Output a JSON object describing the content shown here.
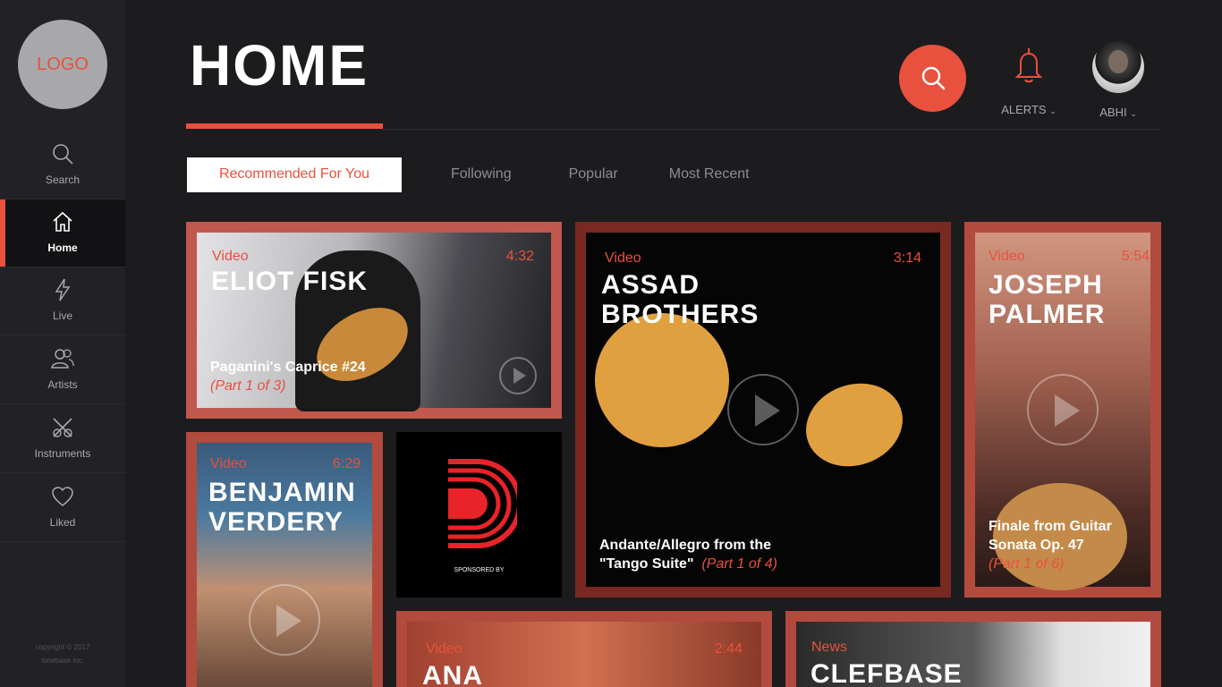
{
  "sidebar": {
    "logo": "LOGO",
    "items": [
      {
        "label": "Search",
        "icon": "search-icon"
      },
      {
        "label": "Home",
        "icon": "home-icon",
        "active": true
      },
      {
        "label": "Live",
        "icon": "lightning-icon"
      },
      {
        "label": "Artists",
        "icon": "artists-icon"
      },
      {
        "label": "Instruments",
        "icon": "instruments-icon"
      },
      {
        "label": "Liked",
        "icon": "heart-icon"
      }
    ],
    "copyright_line1": "copyright © 2017",
    "copyright_line2": "tonebase inc."
  },
  "header": {
    "title": "HOME",
    "alerts_label": "ALERTS",
    "user_label": "ABHI"
  },
  "tabs": [
    {
      "label": "Recommended For You",
      "active": true
    },
    {
      "label": "Following"
    },
    {
      "label": "Popular"
    },
    {
      "label": "Most Recent"
    }
  ],
  "cards": {
    "eliot": {
      "type": "Video",
      "duration": "4:32",
      "name": "ELIOT FISK",
      "subtitle": "Paganini's Caprice #24",
      "part": "(Part 1 of 3)"
    },
    "assad": {
      "type": "Video",
      "duration": "3:14",
      "name_line1": "ASSAD",
      "name_line2": "BROTHERS",
      "subtitle_line1": "Andante/Allegro from the",
      "subtitle_line2": "\"Tango Suite\"",
      "part": "(Part 1 of 4)"
    },
    "joseph": {
      "type": "Video",
      "duration": "5:54",
      "name_line1": "JOSEPH",
      "name_line2": "PALMER",
      "subtitle_line1": "Finale from Guitar",
      "subtitle_line2": "Sonata Op. 47",
      "part": "(Part 1 of 6)"
    },
    "benjamin": {
      "type": "Video",
      "duration": "6:29",
      "name_line1": "BENJAMIN",
      "name_line2": "VERDERY"
    },
    "sponsor": {
      "label": "SPONSORED BY"
    },
    "ana": {
      "type": "Video",
      "duration": "2:44",
      "name": "ANA"
    },
    "clefbase": {
      "type": "News",
      "name": "CLEFBASE"
    }
  },
  "colors": {
    "accent": "#e8513e",
    "background": "#1c1c1f",
    "sidebar": "#222226"
  }
}
